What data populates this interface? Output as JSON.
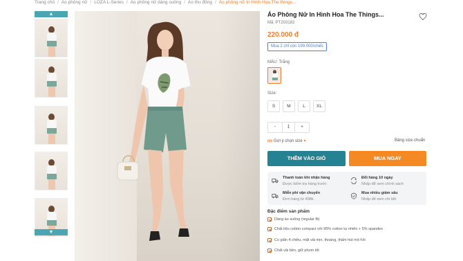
{
  "breadcrumb": [
    "Trang chủ",
    "Áo phông nữ",
    "LOZA L-Series",
    "Áo phông nữ dáng suông",
    "Áo thu đông",
    "Áo phông nữ In Hình Hoa The things..."
  ],
  "product": {
    "title": "Áo Phông Nữ In Hình Hoa The Things...",
    "sku": "Mã: PT203182",
    "price": "220.000 đ",
    "promo": "Mua 2 chỉ còn 199.000/chiếc",
    "color_label": "MÀU: Trắng",
    "size_label": "Size:",
    "sizes": [
      "S",
      "M",
      "L",
      "XL"
    ],
    "quantity": "1",
    "qty_minus": "-",
    "qty_plus": "+",
    "size_suggest": "Gợi ý chọn size",
    "size_guide": "Bảng size chuẩn",
    "add_to_cart": "THÊM VÀO GIỎ",
    "buy_now": "MUA NGAY"
  },
  "services": [
    {
      "title": "Thanh toán khi nhận hàng",
      "sub": "Được kiểm tra hàng trước",
      "icon": "truck-icon"
    },
    {
      "title": "Đổi hàng 10 ngày",
      "sub": "Nhấp để xem chính sách",
      "icon": "exchange-icon"
    },
    {
      "title": "Miễn phí vận chuyển",
      "sub": "Đơn hàng từ 498k",
      "icon": "shipping-icon"
    },
    {
      "title": "Mua nhiều giảm sâu",
      "sub": "Nhấp để xem chi tiết",
      "icon": "badge-icon"
    }
  ],
  "features": {
    "title": "Đặc điểm sản phẩm",
    "items": [
      "Dáng áo suông (regular fit)",
      "Chất liệu cotton compact với 95% cotton tự nhiên + 5% spandex",
      "Co giãn 4 chiều, mặt vải mịn, thoáng, thấm hút mồ hôi",
      "Chất vải bền, giữ phom tốt"
    ]
  },
  "thumb_nav": {
    "up": "▲",
    "down": "▼"
  },
  "colors": {
    "accent": "#f07a2b",
    "teal": "#258292",
    "orange": "#f58a25",
    "blue": "#4a7fd4"
  }
}
